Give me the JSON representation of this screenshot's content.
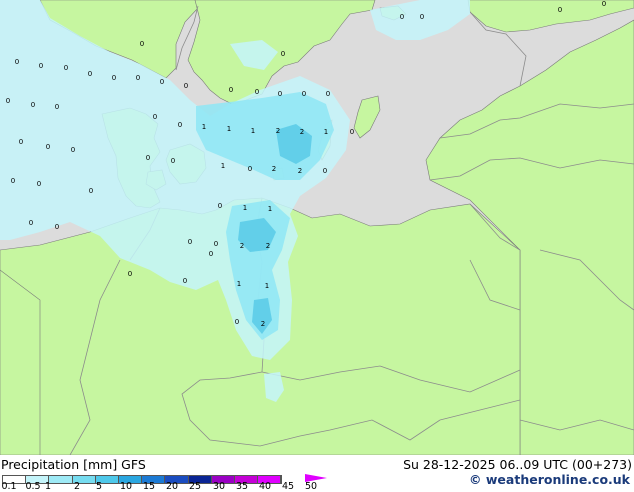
{
  "map": {
    "colors": {
      "sea": "#dcdcdc",
      "land": "#c6f6a0",
      "border": "#8c8c8c",
      "coast": "#7a7a7a",
      "precip_light": "#c4f4fa",
      "precip_mid": "#8ee6f4",
      "precip_strong": "#5ccce8"
    },
    "labels": [
      {
        "value": "0"
      },
      {
        "value": "0"
      },
      {
        "value": "0"
      },
      {
        "value": "0"
      },
      {
        "value": "0"
      },
      {
        "value": "0"
      },
      {
        "value": "0"
      },
      {
        "value": "0"
      },
      {
        "value": "0"
      },
      {
        "value": "0"
      },
      {
        "value": "0"
      },
      {
        "value": "0"
      },
      {
        "value": "0"
      },
      {
        "value": "0"
      },
      {
        "value": "0"
      },
      {
        "value": "0"
      },
      {
        "value": "0"
      },
      {
        "value": "0"
      },
      {
        "value": "0"
      },
      {
        "value": "0"
      },
      {
        "value": "0"
      },
      {
        "value": "0"
      },
      {
        "value": "0"
      },
      {
        "value": "0"
      },
      {
        "value": "0"
      },
      {
        "value": "0"
      },
      {
        "value": "0"
      },
      {
        "value": "0"
      },
      {
        "value": "0"
      },
      {
        "value": "1"
      },
      {
        "value": "1"
      },
      {
        "value": "1"
      },
      {
        "value": "2"
      },
      {
        "value": "2"
      },
      {
        "value": "1"
      },
      {
        "value": "0"
      },
      {
        "value": "0"
      },
      {
        "value": "0"
      },
      {
        "value": "0"
      },
      {
        "value": "0"
      },
      {
        "value": "1"
      },
      {
        "value": "2"
      },
      {
        "value": "2"
      },
      {
        "value": "0"
      },
      {
        "value": "0"
      },
      {
        "value": "0"
      },
      {
        "value": "1"
      },
      {
        "value": "1"
      },
      {
        "value": "0"
      },
      {
        "value": "0"
      },
      {
        "value": "2"
      },
      {
        "value": "2"
      },
      {
        "value": "0"
      },
      {
        "value": "0"
      },
      {
        "value": "0"
      },
      {
        "value": "1"
      },
      {
        "value": "1"
      },
      {
        "value": "0"
      },
      {
        "value": "2"
      },
      {
        "value": "0"
      }
    ]
  },
  "footer": {
    "title": "Precipitation [mm]  GFS",
    "datetime": "Su 28-12-2025 06..09 UTC (00+273)",
    "copyright": "© weatheronline.co.uk",
    "legend": {
      "ticks": [
        "0.1",
        "0.5",
        "1",
        "2",
        "5",
        "10",
        "15",
        "20",
        "25",
        "30",
        "35",
        "40",
        "45",
        "50"
      ],
      "colors": [
        "#ffffff",
        "#c4f4fa",
        "#9eeaf6",
        "#76dcf0",
        "#4ec8ea",
        "#2aa6e0",
        "#1c7ad4",
        "#1a4cc0",
        "#0a2494",
        "#9a00c4",
        "#c400d6",
        "#e000ff"
      ]
    }
  }
}
